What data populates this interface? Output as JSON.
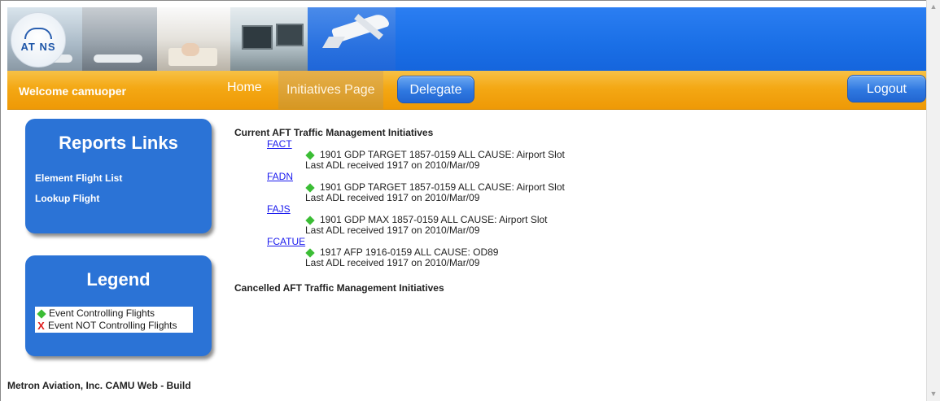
{
  "banner": {
    "logo_text": "AT NS"
  },
  "nav": {
    "welcome": "Welcome camuoper",
    "home": "Home",
    "initiatives": "Initiatives Page",
    "delegate": "Delegate",
    "logout": "Logout"
  },
  "reports": {
    "title": "Reports Links",
    "links": [
      "Element Flight List",
      "Lookup Flight"
    ]
  },
  "legend": {
    "title": "Legend",
    "items": [
      "Event Controlling Flights",
      "Event NOT Controlling Flights"
    ]
  },
  "footer": "Metron Aviation, Inc. CAMU Web - Build",
  "main": {
    "current_title": "Current AFT Traffic Management Initiatives",
    "cancelled_title": "Cancelled AFT Traffic Management Initiatives",
    "initiatives": [
      {
        "airport": "FACT",
        "detail": "1901 GDP TARGET 1857-0159 ALL  CAUSE: Airport Slot",
        "adl": "Last ADL received 1917 on 2010/Mar/09"
      },
      {
        "airport": "FADN",
        "detail": "1901 GDP TARGET 1857-0159 ALL  CAUSE: Airport Slot",
        "adl": "Last ADL received 1917 on 2010/Mar/09"
      },
      {
        "airport": "FAJS",
        "detail": "1901 GDP MAX 1857-0159 ALL  CAUSE: Airport Slot",
        "adl": "Last ADL received 1917 on 2010/Mar/09"
      },
      {
        "airport": "FCATUE",
        "detail": "1917 AFP 1916-0159 ALL  CAUSE: OD89",
        "adl": "Last ADL received 1917 on 2010/Mar/09"
      }
    ]
  },
  "colors": {
    "banner_blue": "#1a6fe6",
    "nav_orange": "#f4a814",
    "box_blue": "#2b73d6",
    "controlling_green": "#3bbd35",
    "not_controlling_red": "#e02020",
    "link_blue": "#1a1aee"
  }
}
